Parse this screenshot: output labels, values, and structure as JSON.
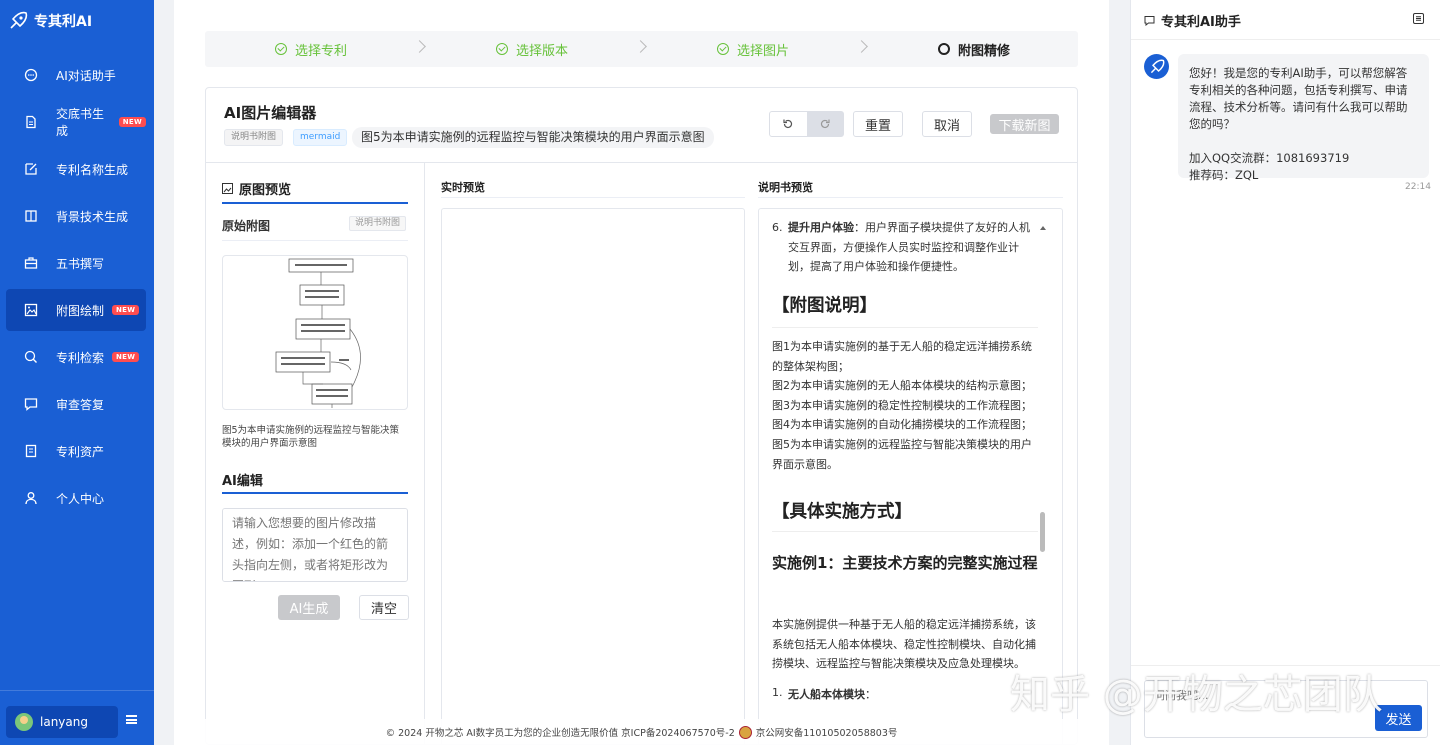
{
  "brand": {
    "name": "专其利AI"
  },
  "nav": [
    {
      "label": "AI对话助手",
      "icon": "chat-icon",
      "new": false
    },
    {
      "label": "交底书生成",
      "icon": "document-icon",
      "new": true
    },
    {
      "label": "专利名称生成",
      "icon": "edit-icon",
      "new": false
    },
    {
      "label": "背景技术生成",
      "icon": "book-icon",
      "new": false
    },
    {
      "label": "五书撰写",
      "icon": "briefcase-icon",
      "new": false
    },
    {
      "label": "附图绘制",
      "icon": "image-icon",
      "new": true,
      "active": true
    },
    {
      "label": "专利检索",
      "icon": "search-icon",
      "new": true
    },
    {
      "label": "审查答复",
      "icon": "message-icon",
      "new": false
    },
    {
      "label": "专利资产",
      "icon": "file-icon",
      "new": false
    },
    {
      "label": "个人中心",
      "icon": "user-icon",
      "new": false
    }
  ],
  "new_badge": "NEW",
  "user": {
    "name": "lanyang"
  },
  "steps": [
    {
      "label": "选择专利",
      "status": "done"
    },
    {
      "label": "选择版本",
      "status": "done"
    },
    {
      "label": "选择图片",
      "status": "done"
    },
    {
      "label": "附图精修",
      "status": "current"
    }
  ],
  "editor": {
    "title": "AI图片编辑器",
    "tags": [
      "说明书附图",
      "mermaid"
    ],
    "description": "图5为本申请实施例的远程监控与智能决策模块的用户界面示意图",
    "undo_icon": "undo-icon",
    "redo_icon": "redo-icon",
    "reset_label": "重置",
    "cancel_label": "取消",
    "download_label": "下载新图"
  },
  "left_panel": {
    "title": "原图预览",
    "original_label": "原始附图",
    "original_tag": "说明书附图",
    "caption": "图5为本申请实施例的远程监控与智能决策模块的用户界面示意图",
    "ai_title": "AI编辑",
    "placeholder": "请输入您想要的图片修改描述，例如：添加一个红色的箭头指向左侧，或者将矩形改为圆形...",
    "generate_label": "AI生成",
    "clear_label": "清空"
  },
  "middle_panel": {
    "title": "实时预览"
  },
  "right_panel": {
    "title": "说明书预览",
    "item6_bold": "提升用户体验",
    "item6_text": "：用户界面子模块提供了友好的人机交互界面，方便操作人员实时监控和调整作业计划，提高了用户体验和操作便捷性。",
    "heading1": "【附图说明】",
    "figs": [
      "图1为本申请实施例的基于无人船的稳定远洋捕捞系统的整体架构图；",
      "图2为本申请实施例的无人船本体模块的结构示意图；",
      "图3为本申请实施例的稳定性控制模块的工作流程图；",
      "图4为本申请实施例的自动化捕捞模块的工作流程图；",
      "图5为本申请实施例的远程监控与智能决策模块的用户界面示意图。"
    ],
    "heading2": "【具体实施方式】",
    "heading3": "实施例1：主要技术方案的完整实施过程",
    "para": "本实施例提供一种基于无人船的稳定远洋捕捞系统，该系统包括无人船本体模块、稳定性控制模块、自动化捕捞模块、远程监控与智能决策模块及应急处理模块。",
    "list1_bold": "无人船本体模块",
    "list1_text": "："
  },
  "footer": {
    "text": "© 2024 开物之芯 AI数字员工为您的企业创造无限价值 京ICP备2024067570号-2",
    "police": "京公网安备11010502058803号"
  },
  "assistant": {
    "title": "专其利AI助手",
    "greeting": "您好！我是您的专利AI助手，可以帮您解答专利相关的各种问题，包括专利撰写、申请流程、技术分析等。请问有什么我可以帮助您的吗？",
    "qq": "加入QQ交流群：1081693719",
    "ref": "推荐码：ZQL",
    "time": "22:14",
    "input_placeholder": "问问我吧...",
    "send_label": "发送"
  },
  "watermark": "知乎 @开物之芯团队",
  "colors": {
    "primary": "#1a5fd4",
    "active": "#0e47b3",
    "done": "#67c23a",
    "new": "#ff4d4f"
  }
}
